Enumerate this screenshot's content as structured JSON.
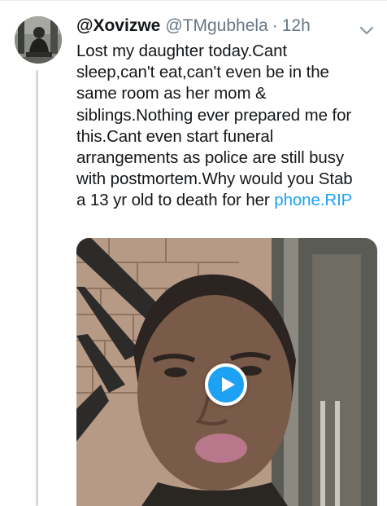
{
  "tweet": {
    "display_name": "@Xovizwe",
    "handle": "@TMgubhela",
    "separator": "·",
    "time": "12h",
    "text_lines": [
      "Lost my daughter today.Cant",
      "sleep,can't eat,can't even be in the",
      "same room as her mom &",
      "siblings.Nothing ever prepared me for",
      "this.Cant even start funeral",
      "arrangements as police are still busy",
      "with postmortem.Why would you Stab",
      "a 13 yr old to death for her "
    ],
    "link_text": "phone.RIP",
    "icons": {
      "avatar": "user-avatar",
      "caret": "chevron-down-icon",
      "play": "play-icon"
    },
    "colors": {
      "link": "#1da1f2",
      "muted": "#657786",
      "play_button": "#1da1f2"
    }
  }
}
